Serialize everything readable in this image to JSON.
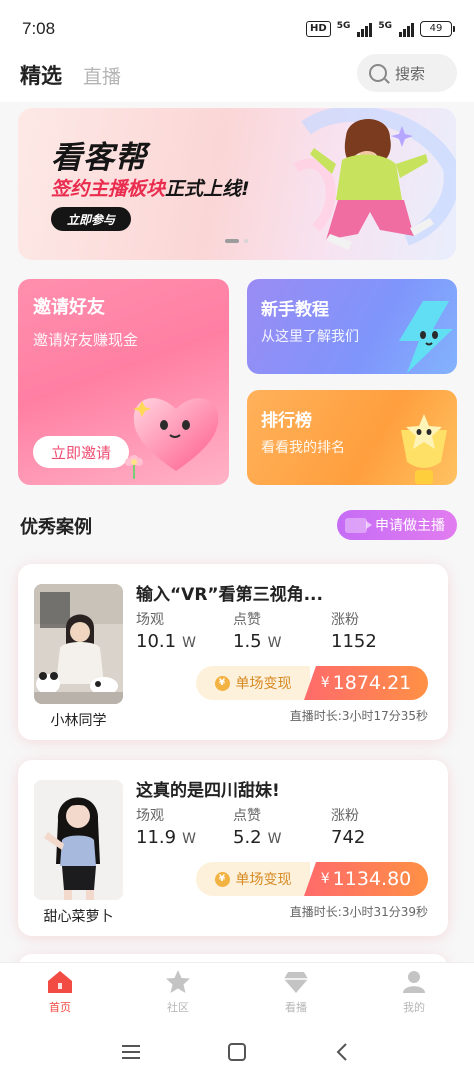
{
  "status": {
    "time": "7:08",
    "hd": "HD",
    "net1": "5G",
    "net2": "5G",
    "battery": "49"
  },
  "header": {
    "tab_active": "精选",
    "tab_inactive": "直播",
    "search_label": "搜索"
  },
  "banner": {
    "title": "看客帮",
    "subtitle_red": "签约主播板块",
    "subtitle_black": "正式上线!",
    "button": "立即参与"
  },
  "features": {
    "invite": {
      "title": "邀请好友",
      "subtitle": "邀请好友赚现金",
      "button": "立即邀请"
    },
    "tutorial": {
      "title": "新手教程",
      "subtitle": "从这里了解我们"
    },
    "ranking": {
      "title": "排行榜",
      "subtitle": "看看我的排名"
    }
  },
  "cases_section": {
    "title": "优秀案例",
    "apply_button": "申请做主播"
  },
  "cases": [
    {
      "title": "输入“VR”看第三视角...",
      "name": "小林同学",
      "views_label": "场观",
      "views": "10.1",
      "views_unit": "W",
      "likes_label": "点赞",
      "likes": "1.5",
      "likes_unit": "W",
      "fans_label": "涨粉",
      "fans": "1152",
      "earn_label": "单场变现",
      "currency": "¥",
      "earnings": "1874.21",
      "duration": "直播时长:3小时17分35秒"
    },
    {
      "title": "这真的是四川甜妹!",
      "name": "甜心菜萝卜",
      "views_label": "场观",
      "views": "11.9",
      "views_unit": "W",
      "likes_label": "点赞",
      "likes": "5.2",
      "likes_unit": "W",
      "fans_label": "涨粉",
      "fans": "742",
      "earn_label": "单场变现",
      "currency": "¥",
      "earnings": "1134.80",
      "duration": "直播时长:3小时31分39秒"
    }
  ],
  "tabbar": [
    {
      "label": "首页",
      "icon": "home-icon",
      "active": true
    },
    {
      "label": "社区",
      "icon": "star-icon",
      "active": false
    },
    {
      "label": "看播",
      "icon": "diamond-icon",
      "active": false
    },
    {
      "label": "我的",
      "icon": "profile-icon",
      "active": false
    }
  ],
  "colors": {
    "accent": "#f24b43",
    "invite": "#ff7fa3",
    "tutorial": "#7f95fb",
    "ranking": "#ff9f3e",
    "apply": "#c66cf5"
  }
}
